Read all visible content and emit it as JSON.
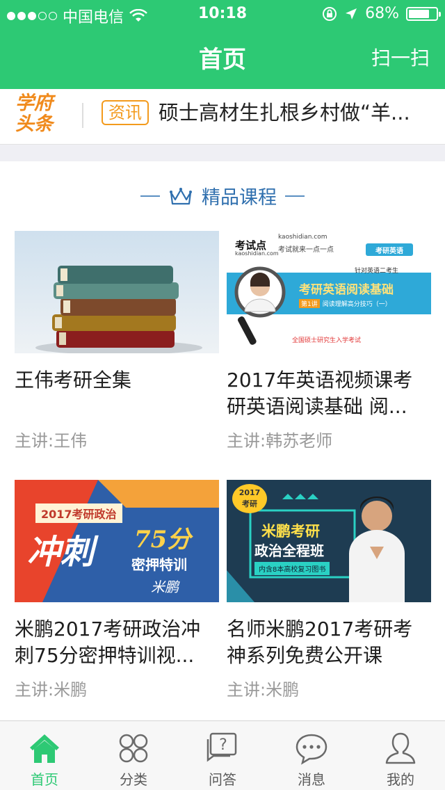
{
  "status_bar": {
    "carrier": "中国电信",
    "time": "10:18",
    "battery": "68%",
    "battery_level": 0.68
  },
  "nav": {
    "title": "首页",
    "scan_label": "扫一扫"
  },
  "news": {
    "logo_line1": "学府",
    "logo_line2": "头条",
    "tag": "资讯",
    "headline": "硕士高材生扎根乡村做“羊..."
  },
  "section": {
    "title": "精品课程"
  },
  "courses": [
    {
      "title": "王伟考研全集",
      "teacher": "主讲:王伟"
    },
    {
      "title": "2017年英语视频课考研英语阅读基础 阅...",
      "teacher": "主讲:韩苏老师",
      "thumb": {
        "brand": "考试点",
        "site": "kaoshidian.com",
        "slogan": "考试就来一点一点",
        "badge": "考研英语",
        "subject": "针对英语二考生",
        "course": "考研英语阅读基础",
        "lesson_no": "第1讲",
        "lesson": "阅读理解高分技巧（一）",
        "footer": "全国硕士研究生入学考试"
      }
    },
    {
      "title": "米鹏2017考研政治冲刺75分密押特训视...",
      "teacher": "主讲:米鹏",
      "thumb": {
        "banner": "2017考研政治",
        "big": "冲刺",
        "score": "75分",
        "sub": "密押特训",
        "sign": "米鹏"
      }
    },
    {
      "title": "名师米鹏2017考研考神系列免费公开课",
      "teacher": "主讲:米鹏",
      "thumb": {
        "badge_year": "2017",
        "badge_text": "考研",
        "line1": "米鹏考研",
        "line2": "政治全程班",
        "note": "内含8本高校复习图书"
      }
    }
  ],
  "tabs": [
    {
      "label": "首页",
      "icon": "home-icon"
    },
    {
      "label": "分类",
      "icon": "category-icon"
    },
    {
      "label": "问答",
      "icon": "qa-icon"
    },
    {
      "label": "消息",
      "icon": "message-icon"
    },
    {
      "label": "我的",
      "icon": "profile-icon"
    }
  ],
  "colors": {
    "brand_green": "#2dc974",
    "news_orange": "#f39a1c",
    "section_blue": "#2f6fae"
  }
}
